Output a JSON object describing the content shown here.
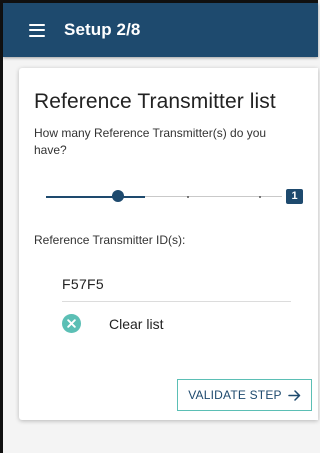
{
  "appbar": {
    "menu_icon": "hamburger-menu-icon",
    "title": "Setup 2/8",
    "color": "#1e4a6e"
  },
  "card": {
    "title": "Reference Transmitter list",
    "question": "How many Reference Transmitter(s) do you have?",
    "slider": {
      "value": 1,
      "badge": "1",
      "accent": "#1e4a6e"
    },
    "ids_label": "Reference Transmitter ID(s):",
    "ids": [
      "F57F5"
    ],
    "clear": {
      "icon": "clear-circle-icon",
      "label": "Clear list",
      "color": "#5bbfb5"
    },
    "validate": {
      "label": "VALIDATE STEP",
      "icon": "arrow-right-icon"
    }
  }
}
